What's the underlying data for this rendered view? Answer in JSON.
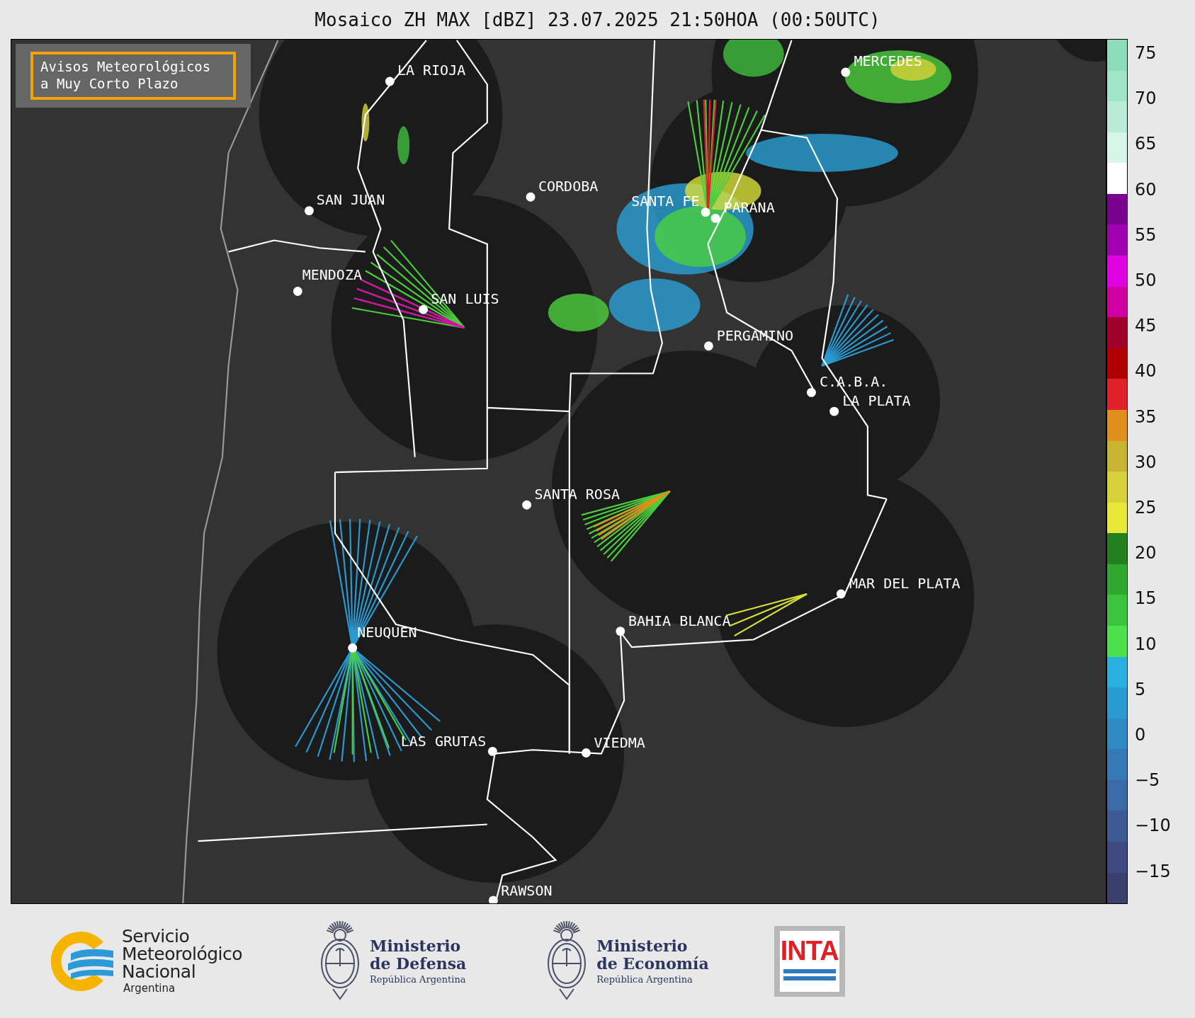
{
  "title": "Mosaico ZH MAX [dBZ] 23.07.2025 21:50HOA (00:50UTC)",
  "notice_box": {
    "lines": [
      "Avisos Meteorológicos",
      "a Muy Corto Plazo"
    ]
  },
  "cities": [
    {
      "name": "LA RIOJA"
    },
    {
      "name": "MERCEDES"
    },
    {
      "name": "CORDOBA"
    },
    {
      "name": "SAN JUAN"
    },
    {
      "name": "SANTA FE"
    },
    {
      "name": "PARANA"
    },
    {
      "name": "MENDOZA"
    },
    {
      "name": "SAN LUIS"
    },
    {
      "name": "PERGAMINO"
    },
    {
      "name": "C.A.B.A."
    },
    {
      "name": "LA PLATA"
    },
    {
      "name": "SANTA ROSA"
    },
    {
      "name": "MAR DEL PLATA"
    },
    {
      "name": "BAHIA BLANCA"
    },
    {
      "name": "NEUQUEN"
    },
    {
      "name": "LAS GRUTAS"
    },
    {
      "name": "VIEDMA"
    },
    {
      "name": "RAWSON"
    }
  ],
  "colorbar": {
    "ticks": [
      "75",
      "70",
      "65",
      "60",
      "55",
      "50",
      "45",
      "40",
      "35",
      "30",
      "25",
      "20",
      "15",
      "10",
      "5",
      "0",
      "−5",
      "−10",
      "−15"
    ]
  },
  "logos": [
    {
      "kind": "smn",
      "lines": [
        "Servicio",
        "Meteorológico",
        "Nacional"
      ],
      "subtitle": "Argentina"
    },
    {
      "kind": "ministry",
      "lines": [
        "Ministerio",
        "de Defensa"
      ],
      "subtitle": "República Argentina"
    },
    {
      "kind": "ministry",
      "lines": [
        "Ministerio",
        "de Economía"
      ],
      "subtitle": "República Argentina"
    },
    {
      "kind": "inta",
      "lines": [
        "INTA"
      ]
    }
  ]
}
